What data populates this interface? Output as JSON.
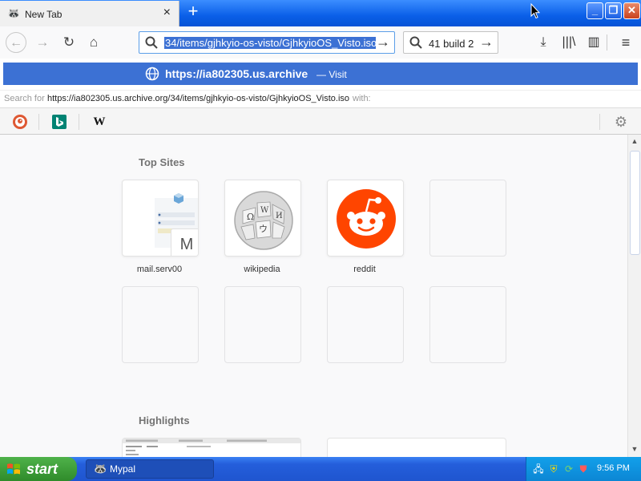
{
  "window": {
    "tab_title": "New Tab",
    "tab_close_icon": "×",
    "new_tab_icon": "+",
    "minimize_icon": "_",
    "maximize_icon": "❐",
    "close_icon": "✕"
  },
  "nav": {
    "back_icon": "←",
    "forward_icon": "→",
    "reload_icon": "↻",
    "home_icon": "⌂",
    "url_value": "34/items/gjhkyio-os-visto/GjhkyioOS_Visto.iso",
    "url_go_icon": "→",
    "search_value": "41 build 2",
    "search_go_icon": "→",
    "download_icon": "⤓",
    "library_icon": "|||\\",
    "sidebar_icon": "▥",
    "menu_icon": "≡"
  },
  "suggestion": {
    "url": "https://ia802305.us.archive",
    "action": "— Visit"
  },
  "search_for": {
    "label": "Search for",
    "query": "https://ia802305.us.archive.org/34/items/gjhkyio-os-visto/GjhkyioOS_Visto.iso",
    "with": "with:"
  },
  "engines": {
    "wiki_letter": "W",
    "settings_icon": "⚙"
  },
  "content": {
    "top_sites_title": "Top Sites",
    "highlights_title": "Highlights",
    "tiles": [
      {
        "label": "mail.serv00",
        "letter": "M"
      },
      {
        "label": "wikipedia"
      },
      {
        "label": "reddit"
      }
    ]
  },
  "taskbar": {
    "start_label": "start",
    "task_label": "Mypal",
    "clock": "9:56 PM"
  },
  "colors": {
    "accent": "#3c71d4",
    "reddit": "#ff4500",
    "taskbar": "#245edb",
    "start": "#3c9a36"
  }
}
